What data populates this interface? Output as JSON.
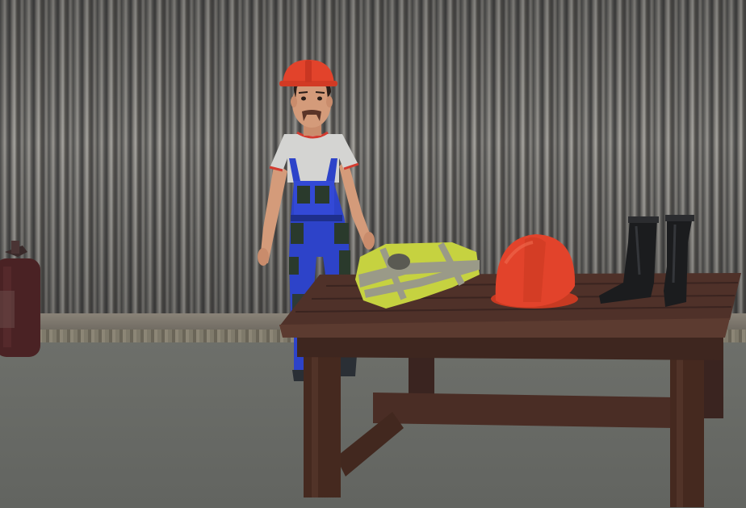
{
  "scene": {
    "objects": [
      "corrugated-metal-wall",
      "worker-character",
      "fire-extinguisher",
      "wooden-table",
      "high-visibility-vest",
      "hard-hat",
      "safety-boots"
    ]
  },
  "colors": {
    "helmet": "#e2432b",
    "overalls": "#2d43c9",
    "vest_yellow": "#c6d240",
    "vest_stripe": "#9a9a88",
    "table_wood": "#4a2d25",
    "boots": "#1b1c1e",
    "extinguisher": "#4a2224"
  }
}
